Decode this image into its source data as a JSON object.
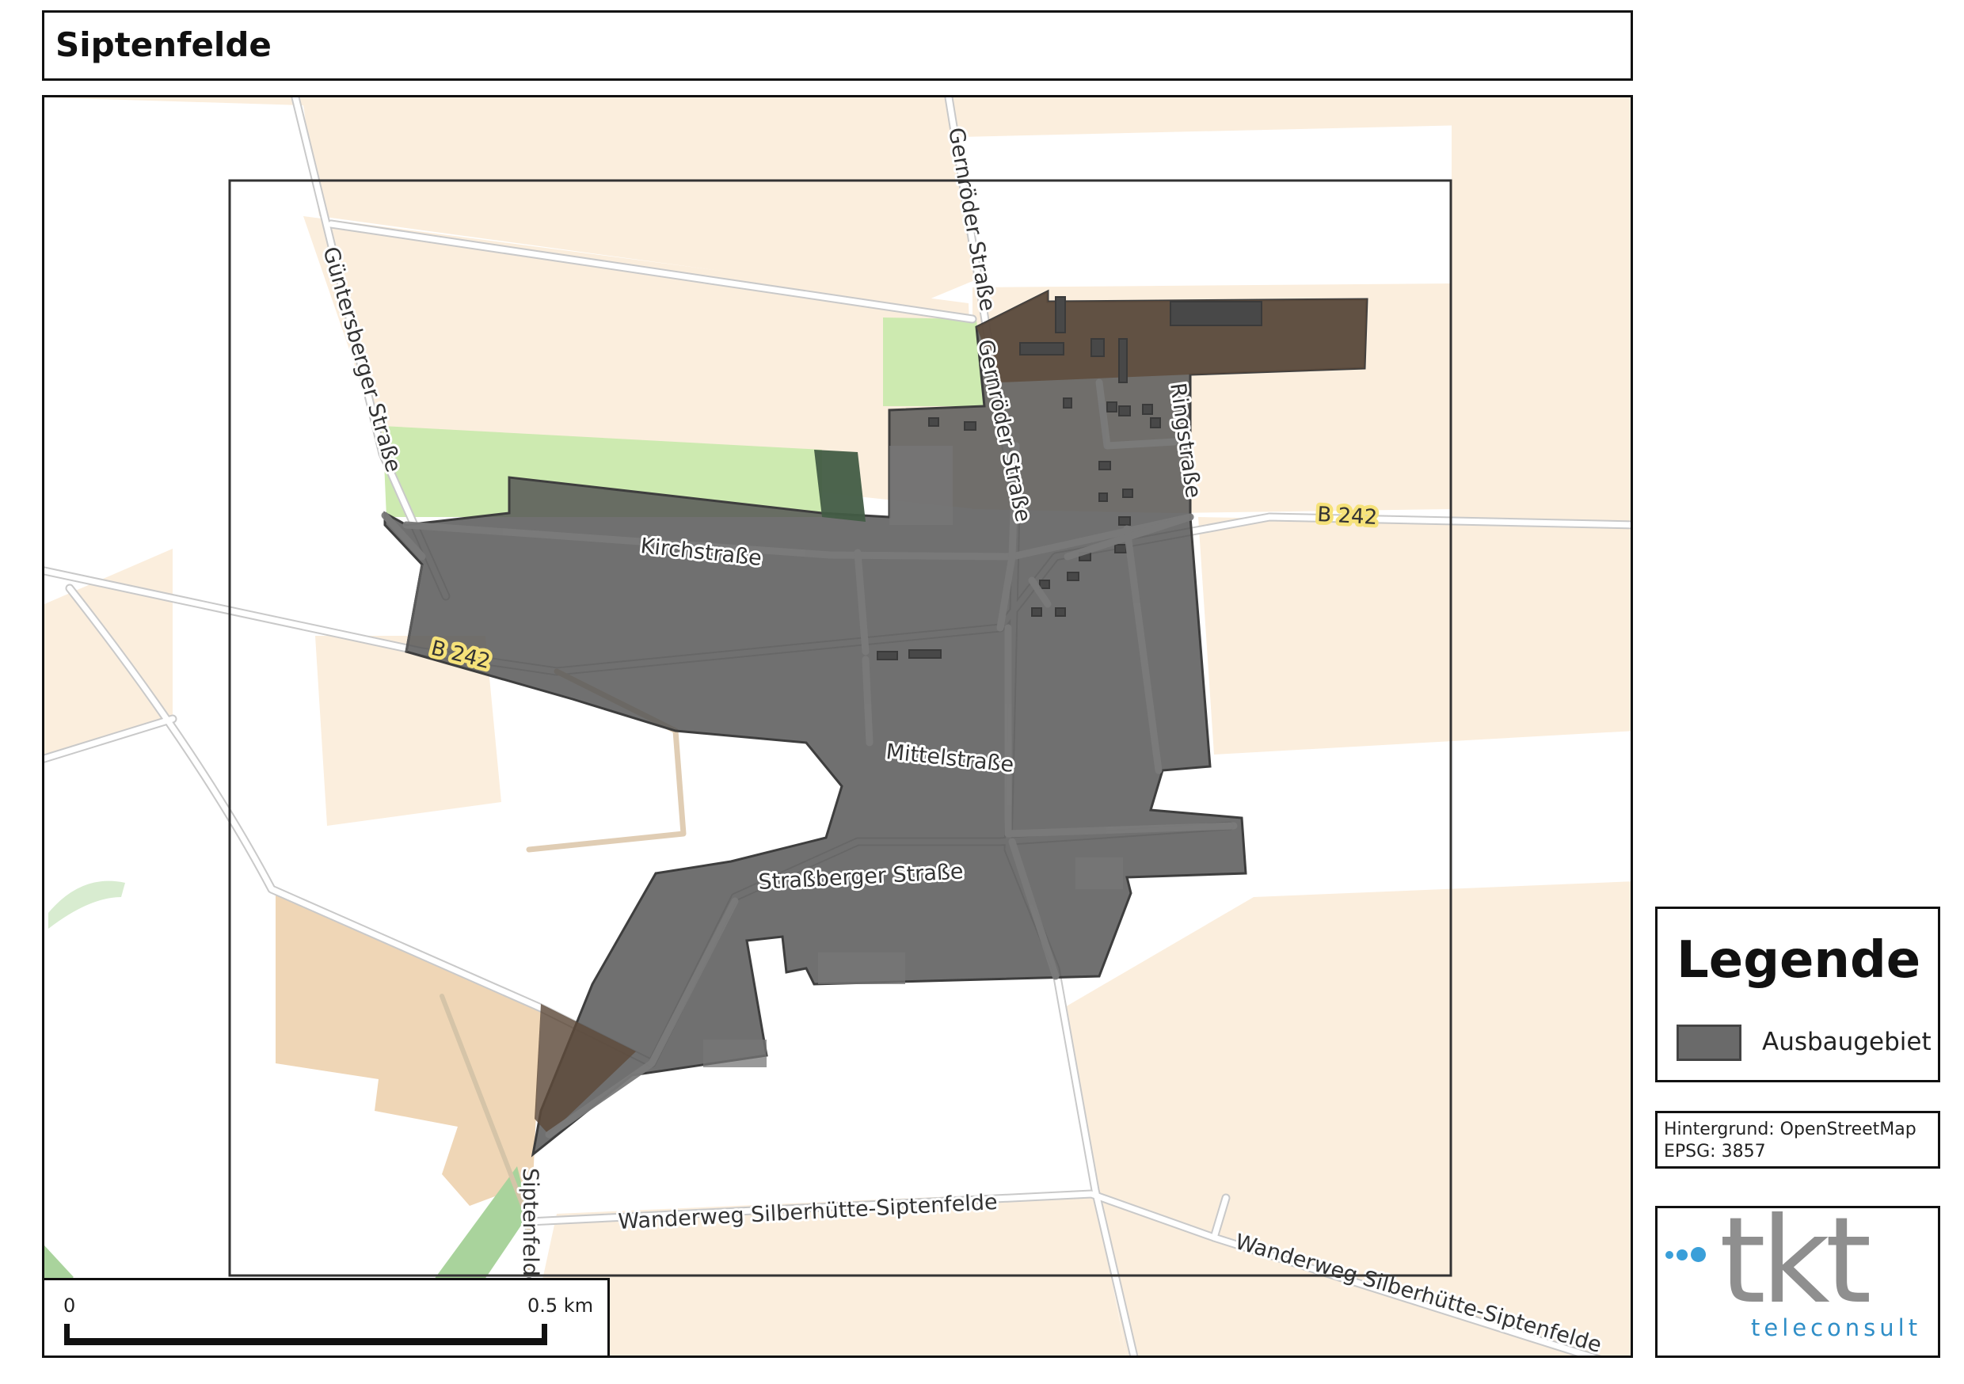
{
  "map": {
    "title": "Siptenfelde",
    "streets": {
      "guentersberger": "Güntersberger Straße",
      "gernroeder_north": "Gernröder Straße",
      "gernroeder_south": "Gernröder Straße",
      "ring": "Ringstraße",
      "b242_east": "B 242",
      "b242_west": "B 242",
      "kirch": "Kirchstraße",
      "mittel": "Mittelstraße",
      "strassberger": "Straßberger Straße",
      "siptenfelde": "Siptenfelde",
      "wanderweg_west": "Wanderweg Silberhütte-Siptenfelde",
      "wanderweg_east": "Wanderweg Silberhütte-Siptenfelde"
    },
    "colors": {
      "farmland": "#fbeedd",
      "grass": "#cdeab0",
      "forest": "#a9d39c",
      "brownfield": "#efd6b6",
      "road": "#ffffff",
      "road_casing": "#c8c8c8",
      "area_fill": "#555555",
      "shield": "#f6e27a"
    }
  },
  "scale": {
    "start_label": "0",
    "end_label": "0.5 km"
  },
  "legend": {
    "title": "Legende",
    "entry_label": "Ausbaugebiet",
    "entry_color": "#6a6a6a"
  },
  "source": {
    "background": "Hintergrund: OpenStreetMap",
    "crs": "EPSG: 3857"
  },
  "logo": {
    "brand": "tkt",
    "subtitle": "teleconsult",
    "accent_color": "#3a9fd9"
  }
}
